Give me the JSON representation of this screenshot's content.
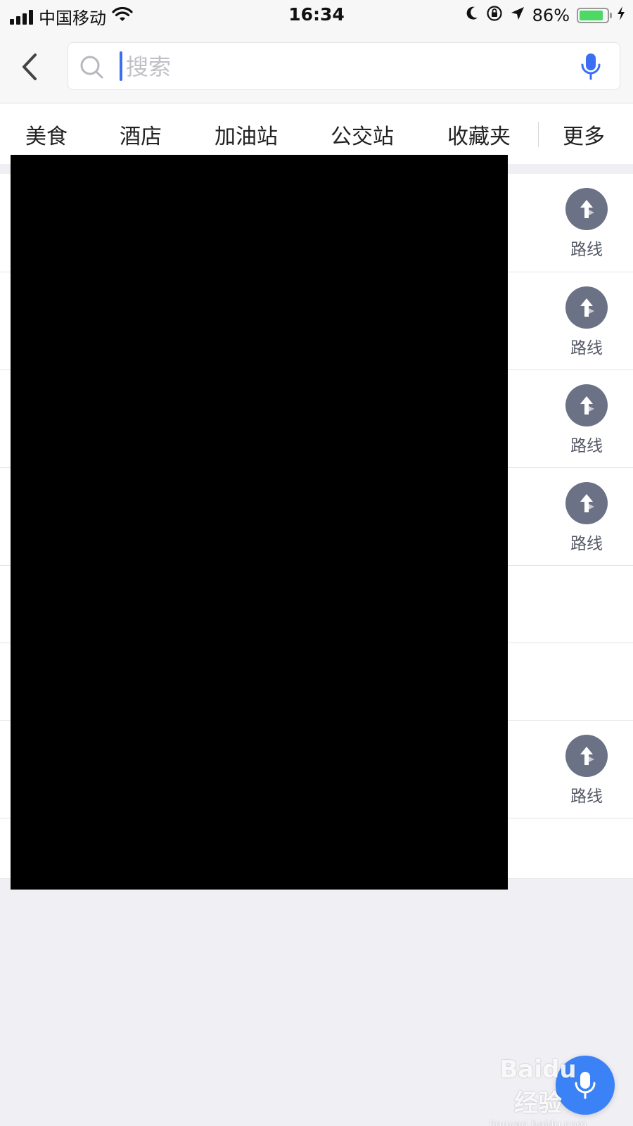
{
  "status_bar": {
    "carrier": "中国移动",
    "time": "16:34",
    "battery_percent": "86%",
    "battery_level": 0.86,
    "icons": [
      "signal-icon",
      "wifi-icon",
      "moon-icon",
      "rotation-lock-icon",
      "location-arrow-icon",
      "battery-icon",
      "charging-icon"
    ]
  },
  "header": {
    "search_placeholder": "搜索"
  },
  "categories": [
    "美食",
    "酒店",
    "加油站",
    "公交站",
    "收藏夹",
    "更多"
  ],
  "results": [
    {
      "route_label": "路线"
    },
    {
      "route_label": "路线"
    },
    {
      "route_label": "路线"
    },
    {
      "route_label": "路线"
    },
    {
      "route_label": ""
    },
    {
      "route_label": ""
    },
    {
      "route_label": "路线"
    },
    {
      "route_label": ""
    }
  ],
  "watermark": {
    "main": "Baidu 经验",
    "sub": "jingyan.baidu.com"
  },
  "colors": {
    "accent": "#3a6ff3",
    "route_button": "#6b7285",
    "battery": "#4cd964",
    "fab": "#3b82f6"
  }
}
